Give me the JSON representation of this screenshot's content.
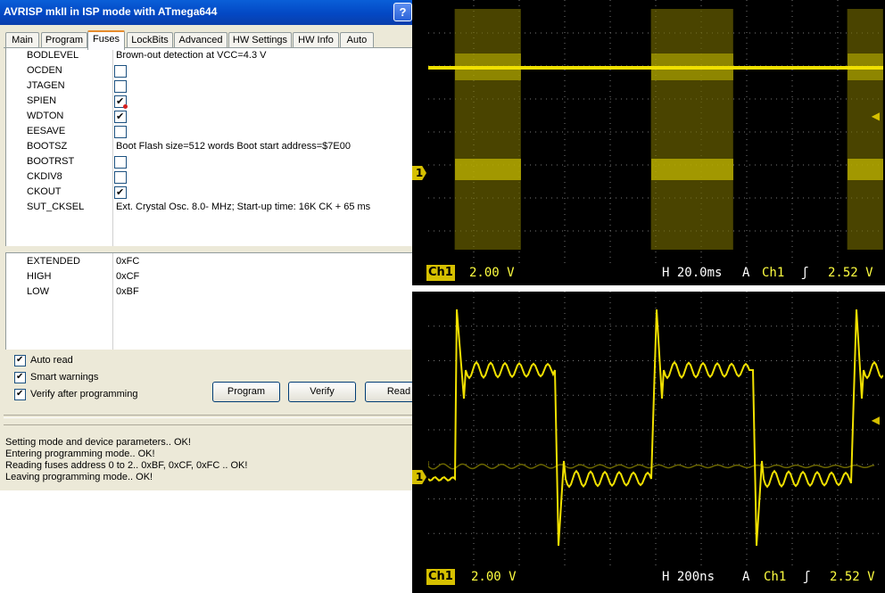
{
  "window": {
    "title": "AVRISP mkII in ISP mode with ATmega644",
    "help_button": "?"
  },
  "tabs": [
    "Main",
    "Program",
    "Fuses",
    "LockBits",
    "Advanced",
    "HW Settings",
    "HW Info",
    "Auto"
  ],
  "active_tab": "Fuses",
  "fuses": [
    {
      "name": "BODLEVEL",
      "value": "Brown-out detection at VCC=4.3 V"
    },
    {
      "name": "OCDEN",
      "checked": false
    },
    {
      "name": "JTAGEN",
      "checked": false
    },
    {
      "name": "SPIEN",
      "checked": true,
      "locked": true
    },
    {
      "name": "WDTON",
      "checked": true
    },
    {
      "name": "EESAVE",
      "checked": false
    },
    {
      "name": "BOOTSZ",
      "value": "Boot Flash size=512 words Boot start address=$7E00"
    },
    {
      "name": "BOOTRST",
      "checked": false
    },
    {
      "name": "CKDIV8",
      "checked": false
    },
    {
      "name": "CKOUT",
      "checked": true
    },
    {
      "name": "SUT_CKSEL",
      "value": "Ext. Crystal Osc. 8.0-    MHz; Start-up time: 16K CK + 65 ms"
    }
  ],
  "fuse_bytes": [
    {
      "name": "EXTENDED",
      "value": "0xFC"
    },
    {
      "name": "HIGH",
      "value": "0xCF"
    },
    {
      "name": "LOW",
      "value": "0xBF"
    }
  ],
  "options": [
    {
      "label": "Auto read",
      "checked": true
    },
    {
      "label": "Smart warnings",
      "checked": true
    },
    {
      "label": "Verify after programming",
      "checked": true
    }
  ],
  "buttons": {
    "program": "Program",
    "verify": "Verify",
    "read": "Read"
  },
  "log": [
    "Setting mode and device parameters.. OK!",
    "Entering programming mode.. OK!",
    "Reading fuses address 0 to 2.. 0xBF, 0xCF, 0xFC .. OK!",
    "Leaving programming mode.. OK!"
  ],
  "scope_top": {
    "channel": "Ch1",
    "volts_div": "2.00 V",
    "timebase": "H 20.0ms",
    "trigger_mode": "A",
    "trigger_channel": "Ch1",
    "trigger_level": "2.52 V",
    "ground_marker": "1",
    "colors": {
      "trace": "#e8e000",
      "grid": "#555555"
    }
  },
  "scope_bottom": {
    "channel": "Ch1",
    "volts_div": "2.00 V",
    "timebase": "H 200ns",
    "trigger_mode": "A",
    "trigger_channel": "Ch1",
    "trigger_level": "2.52 V",
    "ground_marker": "1"
  }
}
